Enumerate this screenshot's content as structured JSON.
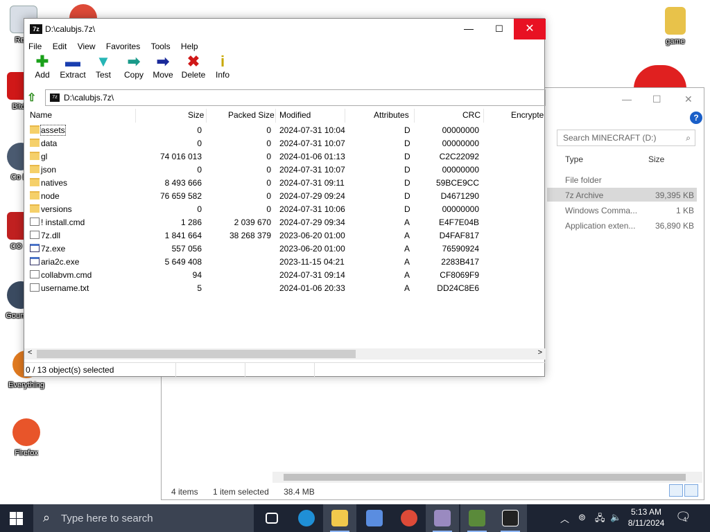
{
  "desktop": {
    "icons": [
      {
        "label": "Recy",
        "name": "recycle-bin"
      },
      {
        "label": "game",
        "name": "game"
      },
      {
        "label": "Bitde",
        "name": "bitdefender"
      },
      {
        "label": "Co\nDr",
        "name": "shortcut-co"
      },
      {
        "label": "CO\nFr",
        "name": "shortcut-fr"
      },
      {
        "label": "Goun\nSo",
        "name": "shortcut-so"
      },
      {
        "label": "Everything",
        "name": "everything"
      },
      {
        "label": "Firefox",
        "name": "firefox"
      }
    ]
  },
  "explorer": {
    "search_placeholder": "Search MINECRAFT (D:)",
    "col_type": "Type",
    "col_size": "Size",
    "rows": [
      {
        "type": "File folder",
        "size": ""
      },
      {
        "type": "7z Archive",
        "size": "39,395 KB"
      },
      {
        "type": "Windows Comma...",
        "size": "1 KB"
      },
      {
        "type": "Application exten...",
        "size": "36,890 KB"
      }
    ],
    "status_items": "4 items",
    "status_selected": "1 item selected",
    "status_size": "38.4 MB",
    "help_label": "?"
  },
  "sevenzip": {
    "title": "D:\\calubjs.7z\\",
    "app_icon": "7z",
    "window_controls": {
      "minimize": "—",
      "maximize": "☐",
      "close": "✕"
    },
    "menu": [
      "File",
      "Edit",
      "View",
      "Favorites",
      "Tools",
      "Help"
    ],
    "toolbar": [
      {
        "label": "Add",
        "icon": "plus-icon",
        "glyph": "✚",
        "color": "#1aa01a"
      },
      {
        "label": "Extract",
        "icon": "minus-icon",
        "glyph": "▬",
        "color": "#1a3fb0"
      },
      {
        "label": "Test",
        "icon": "check-icon",
        "glyph": "▼",
        "color": "#26b5b5"
      },
      {
        "label": "Copy",
        "icon": "copy-arrow-icon",
        "glyph": "➡",
        "color": "#1a9a8a"
      },
      {
        "label": "Move",
        "icon": "move-arrow-icon",
        "glyph": "➡",
        "color": "#1a2a9a"
      },
      {
        "label": "Delete",
        "icon": "delete-x-icon",
        "glyph": "✖",
        "color": "#d01818"
      },
      {
        "label": "Info",
        "icon": "info-icon",
        "glyph": "i",
        "color": "#c8a800"
      }
    ],
    "address": "D:\\calubjs.7z\\",
    "columns": [
      "Name",
      "Size",
      "Packed Size",
      "Modified",
      "Attributes",
      "CRC",
      "Encrypte"
    ],
    "files": [
      {
        "name": "assets",
        "kind": "folder",
        "size": "0",
        "packed": "0",
        "modified": "2024-07-31 10:04",
        "attr": "D",
        "crc": "00000000"
      },
      {
        "name": "data",
        "kind": "folder",
        "size": "0",
        "packed": "0",
        "modified": "2024-07-31 10:07",
        "attr": "D",
        "crc": "00000000"
      },
      {
        "name": "gl",
        "kind": "folder",
        "size": "74 016 013",
        "packed": "0",
        "modified": "2024-01-06 01:13",
        "attr": "D",
        "crc": "C2C22092"
      },
      {
        "name": "json",
        "kind": "folder",
        "size": "0",
        "packed": "0",
        "modified": "2024-07-31 10:07",
        "attr": "D",
        "crc": "00000000"
      },
      {
        "name": "natives",
        "kind": "folder",
        "size": "8 493 666",
        "packed": "0",
        "modified": "2024-07-31 09:11",
        "attr": "D",
        "crc": "59BCE9CC"
      },
      {
        "name": "node",
        "kind": "folder",
        "size": "76 659 582",
        "packed": "0",
        "modified": "2024-07-29 09:24",
        "attr": "D",
        "crc": "D4671290"
      },
      {
        "name": "versions",
        "kind": "folder",
        "size": "0",
        "packed": "0",
        "modified": "2024-07-31 10:06",
        "attr": "D",
        "crc": "00000000"
      },
      {
        "name": "! install.cmd",
        "kind": "file",
        "size": "1 286",
        "packed": "2 039 670",
        "modified": "2024-07-29 09:34",
        "attr": "A",
        "crc": "E4F7E04B"
      },
      {
        "name": "7z.dll",
        "kind": "file",
        "size": "1 841 664",
        "packed": "38 268 379",
        "modified": "2023-06-20 01:00",
        "attr": "A",
        "crc": "D4FAF817"
      },
      {
        "name": "7z.exe",
        "kind": "exe",
        "size": "557 056",
        "packed": "",
        "modified": "2023-06-20 01:00",
        "attr": "A",
        "crc": "76590924"
      },
      {
        "name": "aria2c.exe",
        "kind": "exe",
        "size": "5 649 408",
        "packed": "",
        "modified": "2023-11-15 04:21",
        "attr": "A",
        "crc": "2283B417"
      },
      {
        "name": "collabvm.cmd",
        "kind": "file",
        "size": "94",
        "packed": "",
        "modified": "2024-07-31 09:14",
        "attr": "A",
        "crc": "CF8069F9"
      },
      {
        "name": "username.txt",
        "kind": "file",
        "size": "5",
        "packed": "",
        "modified": "2024-01-06 20:33",
        "attr": "A",
        "crc": "DD24C8E6"
      }
    ],
    "status": "0 / 13 object(s) selected",
    "scroll_left": "<",
    "scroll_right": ">"
  },
  "taskbar": {
    "search_placeholder": "Type here to search",
    "apps": [
      {
        "name": "task-view",
        "color": "#1d2433"
      },
      {
        "name": "edge",
        "color": "#1f8fd6"
      },
      {
        "name": "file-explorer",
        "color": "#f2c94c"
      },
      {
        "name": "store",
        "color": "#5a8de0"
      },
      {
        "name": "chrome",
        "color": "#dd4a38"
      },
      {
        "name": "paint",
        "color": "#9a8ac0"
      },
      {
        "name": "minecraft",
        "color": "#5a8a3a"
      },
      {
        "name": "7zip",
        "color": "#222222"
      }
    ],
    "time": "5:13 AM",
    "date": "8/11/2024",
    "notifications": "4"
  }
}
